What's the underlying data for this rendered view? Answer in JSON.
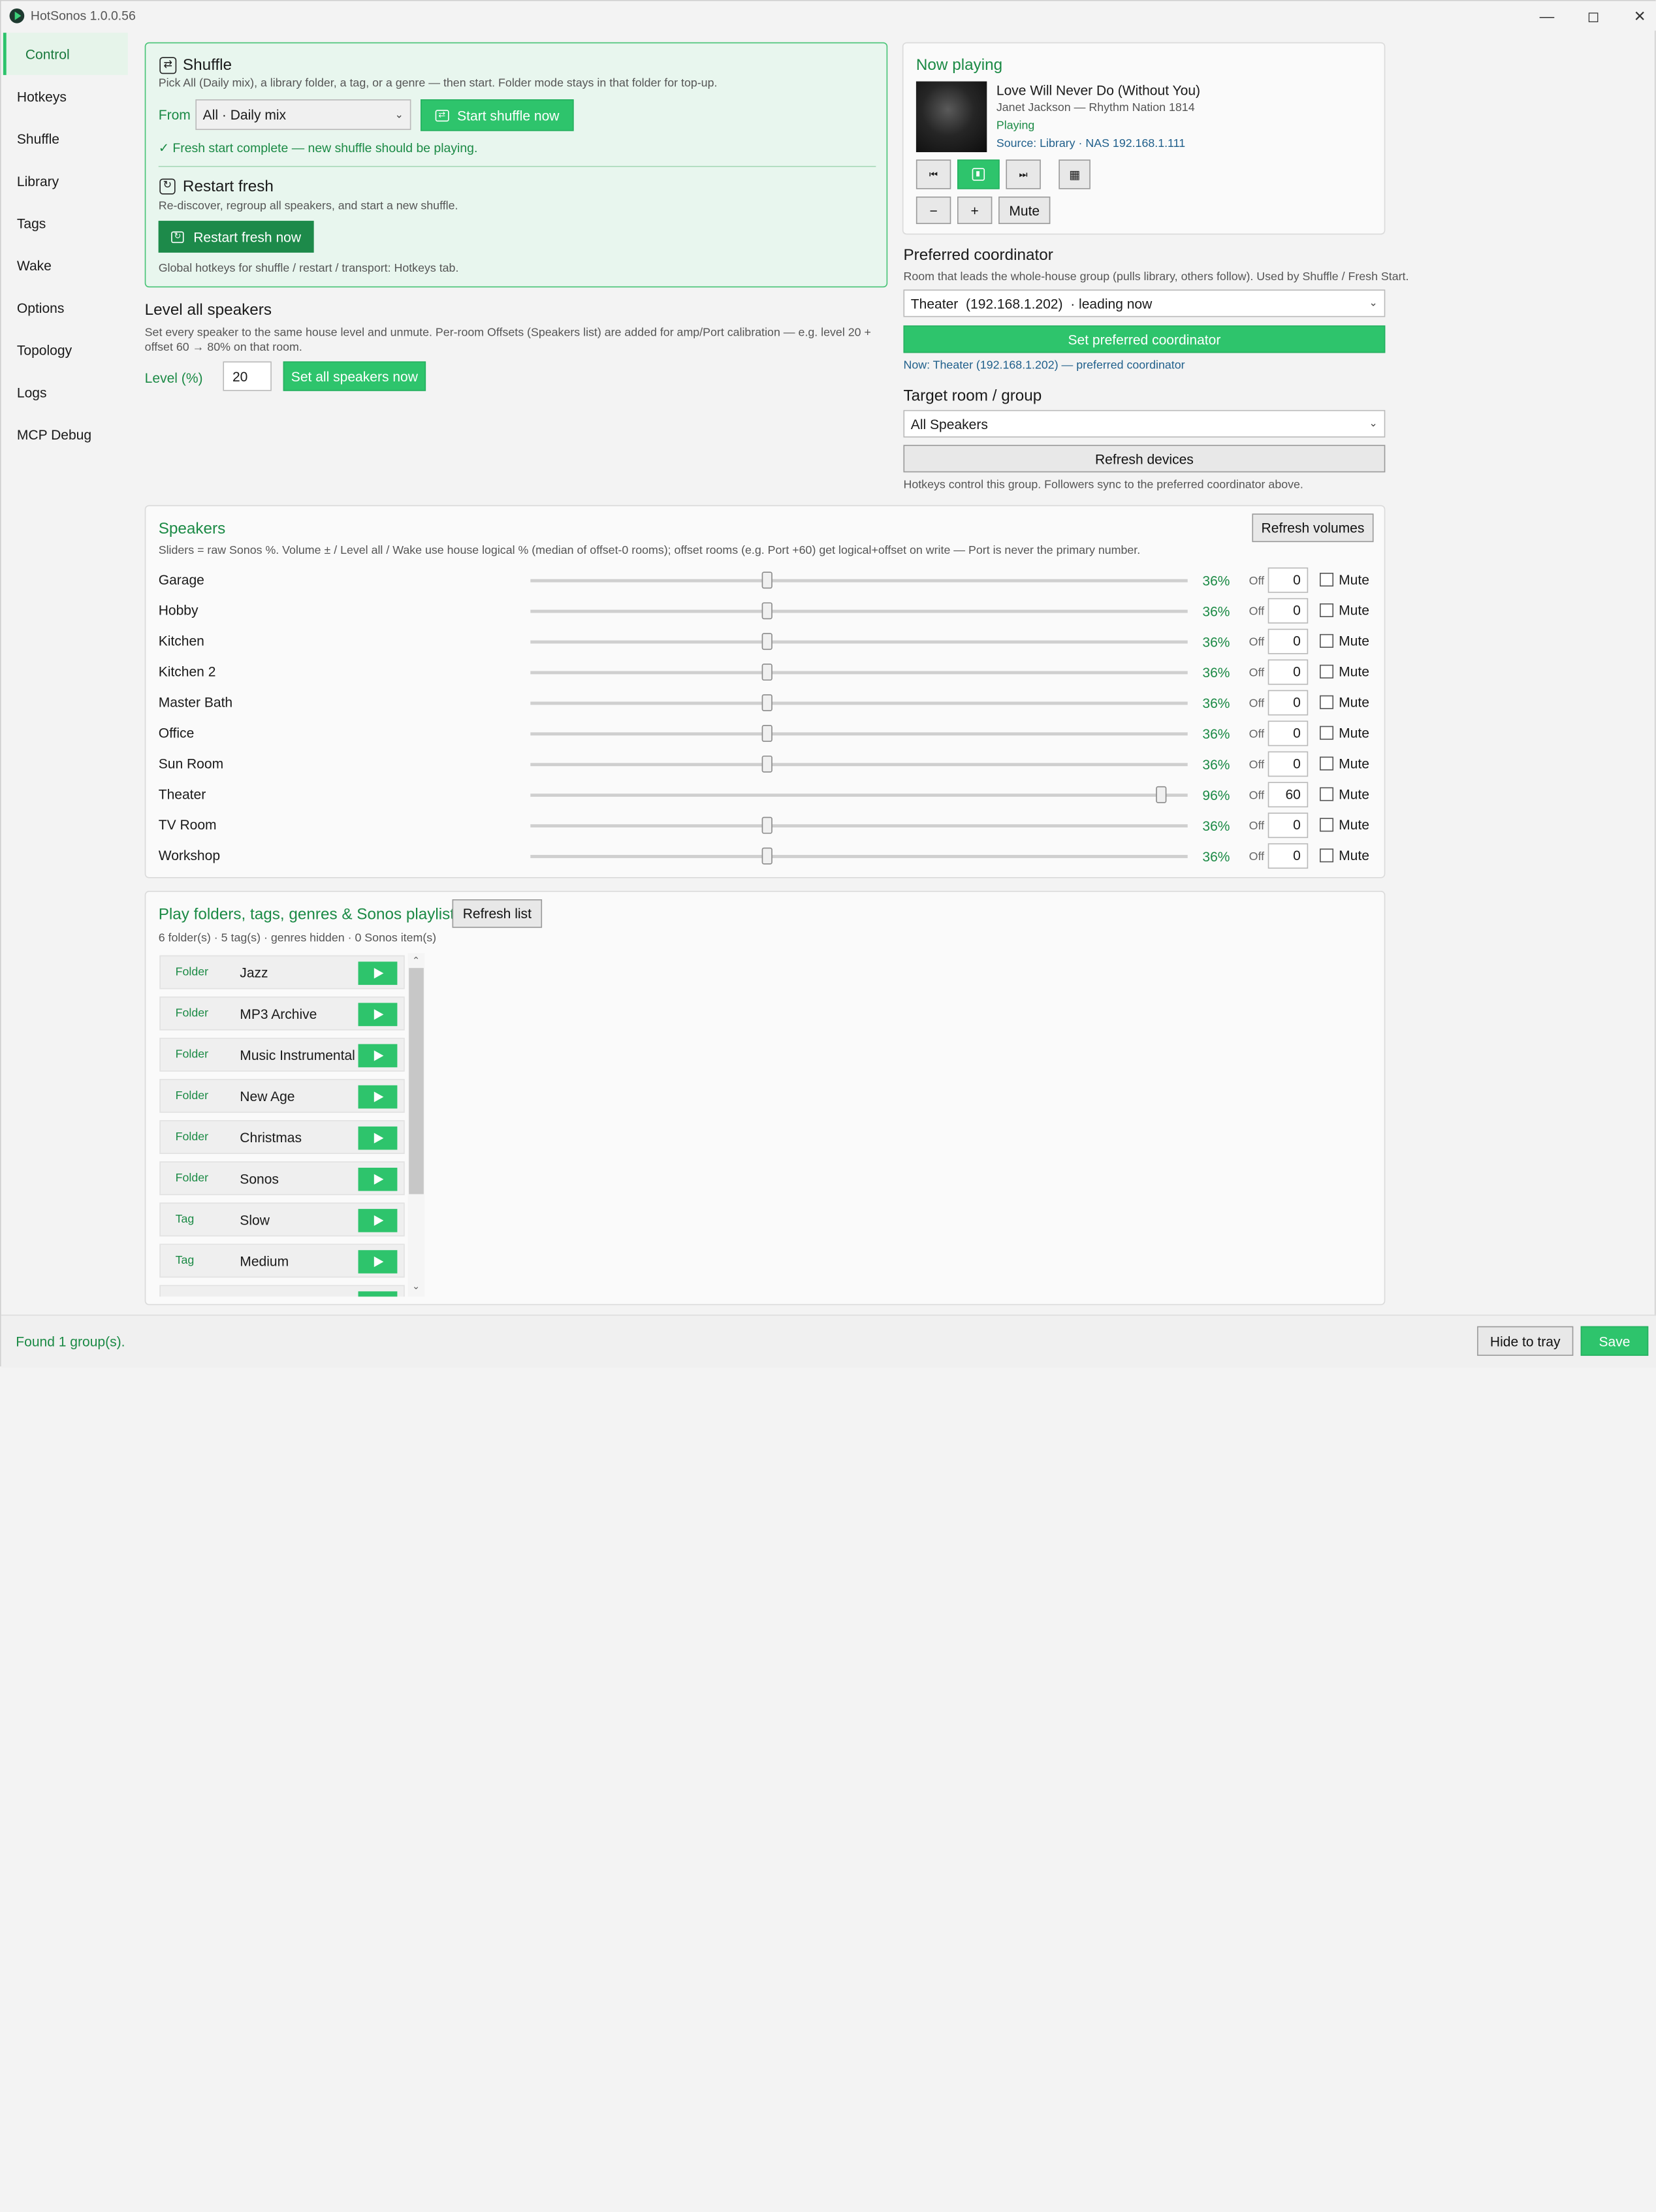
{
  "window": {
    "title": "HotSonos 1.0.0.56"
  },
  "nav": [
    "Control",
    "Hotkeys",
    "Shuffle",
    "Library",
    "Tags",
    "Wake",
    "Options",
    "Topology",
    "Logs",
    "MCP Debug"
  ],
  "shuffle": {
    "title": "Shuffle",
    "desc": "Pick All (Daily mix), a library folder, a tag, or a genre — then start. Folder mode stays in that folder for top-up.",
    "from_label": "From",
    "from_value": "All · Daily mix",
    "start_label": "Start shuffle now",
    "status": "✓ Fresh start complete — new shuffle should be playing.",
    "restart_title": "Restart fresh",
    "restart_desc": "Re-discover, regroup all speakers, and start a new shuffle.",
    "restart_button": "Restart fresh now",
    "hotkeys_note": "Global hotkeys for shuffle / restart / transport: Hotkeys tab."
  },
  "level": {
    "title": "Level all speakers",
    "desc": "Set every speaker to the same house level and unmute. Per-room Offsets (Speakers list) are added for amp/Port calibration — e.g. level 20 + offset 60 → 80% on that room.",
    "label": "Level (%)",
    "value": "20",
    "button": "Set all speakers now"
  },
  "now_playing": {
    "heading": "Now playing",
    "track": "Love Will Never Do (Without You)",
    "artist_album": "Janet Jackson — Rhythm Nation 1814",
    "state": "Playing",
    "source": "Source: Library · NAS 192.168.1.111",
    "minus": "−",
    "plus": "+",
    "mute": "Mute"
  },
  "coordinator": {
    "title": "Preferred coordinator",
    "desc": "Room that leads the whole-house group (pulls library, others follow). Used by Shuffle / Fresh Start.",
    "value": "Theater  (192.168.1.202)  · leading now",
    "set_button": "Set preferred coordinator",
    "now": "Now: Theater (192.168.1.202) — preferred coordinator"
  },
  "target": {
    "title": "Target room / group",
    "value": "All Speakers",
    "refresh": "Refresh devices",
    "note": "Hotkeys control this group. Followers sync to the preferred coordinator above."
  },
  "speakers": {
    "title": "Speakers",
    "refresh": "Refresh volumes",
    "desc": "Sliders = raw Sonos %. Volume ± / Level all / Wake use house logical % (median of offset-0 rooms); offset rooms (e.g. Port +60) get logical+offset on write — Port is never the primary number.",
    "off_label": "Off",
    "mute_label": "Mute",
    "rows": [
      {
        "name": "Garage",
        "volume": 36,
        "pct": "36%",
        "offset": "0"
      },
      {
        "name": "Hobby",
        "volume": 36,
        "pct": "36%",
        "offset": "0"
      },
      {
        "name": "Kitchen",
        "volume": 36,
        "pct": "36%",
        "offset": "0"
      },
      {
        "name": "Kitchen 2",
        "volume": 36,
        "pct": "36%",
        "offset": "0"
      },
      {
        "name": "Master Bath",
        "volume": 36,
        "pct": "36%",
        "offset": "0"
      },
      {
        "name": "Office",
        "volume": 36,
        "pct": "36%",
        "offset": "0"
      },
      {
        "name": "Sun Room",
        "volume": 36,
        "pct": "36%",
        "offset": "0"
      },
      {
        "name": "Theater",
        "volume": 96,
        "pct": "96%",
        "offset": "60"
      },
      {
        "name": "TV Room",
        "volume": 36,
        "pct": "36%",
        "offset": "0"
      },
      {
        "name": "Workshop",
        "volume": 36,
        "pct": "36%",
        "offset": "0"
      }
    ]
  },
  "playlists": {
    "title": "Play folders, tags, genres & Sonos playlists",
    "refresh": "Refresh list",
    "summary": "6 folder(s) · 5 tag(s) · genres hidden · 0 Sonos item(s)",
    "items": [
      {
        "kind": "Folder",
        "name": "Jazz"
      },
      {
        "kind": "Folder",
        "name": "MP3 Archive"
      },
      {
        "kind": "Folder",
        "name": "Music Instrumental"
      },
      {
        "kind": "Folder",
        "name": "New Age"
      },
      {
        "kind": "Folder",
        "name": "Christmas"
      },
      {
        "kind": "Folder",
        "name": "Sonos"
      },
      {
        "kind": "Tag",
        "name": "Slow"
      },
      {
        "kind": "Tag",
        "name": "Medium"
      }
    ]
  },
  "footer": {
    "status": "Found 1 group(s).",
    "hide": "Hide to tray",
    "save": "Save"
  },
  "colors": {
    "accent": "#2ec46c",
    "accent_dark": "#1d8a4a",
    "text_green": "#1b8a45",
    "link_blue": "#1f5f8b"
  }
}
